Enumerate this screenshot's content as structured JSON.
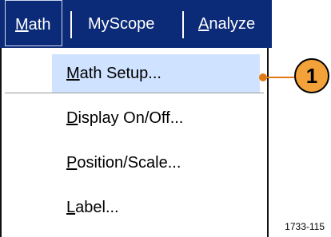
{
  "menubar": {
    "tabs": [
      {
        "key": "M",
        "rest": "ath",
        "label": "Math"
      },
      {
        "key": "",
        "rest": "MyScope",
        "label": "MyScope"
      },
      {
        "key": "A",
        "rest": "nalyze",
        "label": "Analyze"
      }
    ]
  },
  "dropdown": {
    "items": [
      {
        "key": "M",
        "rest": "ath Setup...",
        "label": "Math Setup..."
      },
      {
        "key": "D",
        "rest": "isplay On/Off...",
        "label": "Display On/Off..."
      },
      {
        "key": "P",
        "rest": "osition/Scale...",
        "label": "Position/Scale..."
      },
      {
        "key": "L",
        "rest": "abel...",
        "label": "Label..."
      }
    ]
  },
  "callout": {
    "number": "1"
  },
  "figure_id": "1733-115",
  "colors": {
    "menubar": "#0b2a78",
    "callout": "#f3a23a",
    "leader": "#e07a16",
    "selected": "#cfe2ff"
  }
}
